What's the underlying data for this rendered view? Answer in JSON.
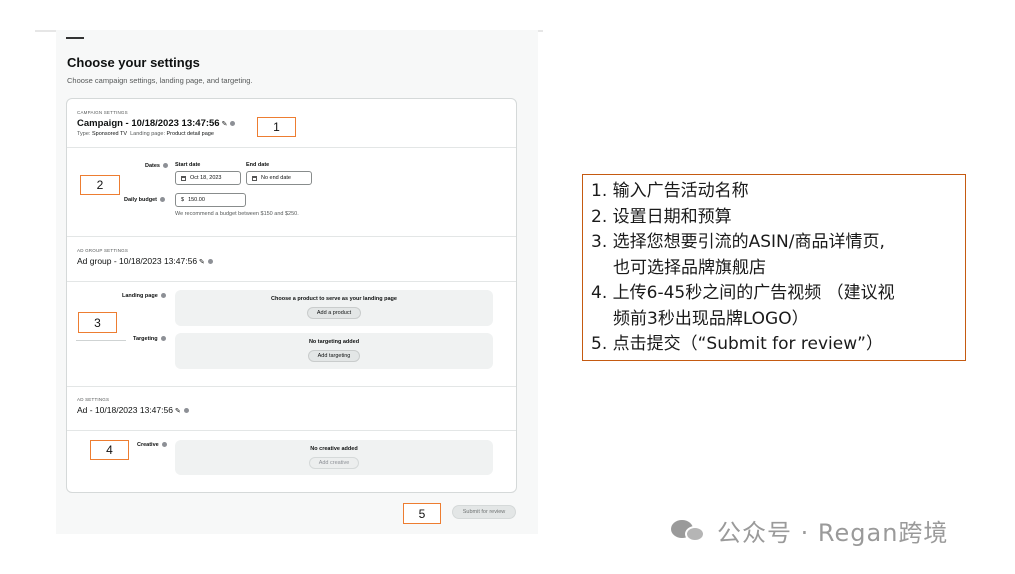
{
  "page": {
    "title": "Choose your settings",
    "subtitle": "Choose campaign settings, landing page, and targeting."
  },
  "campaign": {
    "section_label": "CAMPAIGN SETTINGS",
    "title": "Campaign - 10/18/2023 13:47:56",
    "type_key": "Type:",
    "type_value": "Sponsored TV",
    "landing_key": "Landing page:",
    "landing_value": "Product detail page",
    "dates_label": "Dates",
    "start_date_label": "Start date",
    "start_date_value": "Oct 18, 2023",
    "end_date_label": "End date",
    "end_date_value": "No end date",
    "budget_label": "Daily budget",
    "budget_currency": "$",
    "budget_value": "150.00",
    "budget_hint": "We recommend a budget between $150 and $250."
  },
  "ad_group": {
    "section_label": "AD GROUP SETTINGS",
    "title": "Ad group - 10/18/2023 13:47:56",
    "landing_label": "Landing page",
    "landing_box_text": "Choose a product to serve as your landing page",
    "add_product": "Add a product",
    "targeting_label": "Targeting",
    "targeting_box_text": "No targeting added",
    "add_targeting": "Add targeting"
  },
  "ad": {
    "section_label": "AD SETTINGS",
    "title": "Ad - 10/18/2023 13:47:56",
    "creative_label": "Creative",
    "creative_box_text": "No creative added",
    "add_creative": "Add creative"
  },
  "submit_label": "Submit for review",
  "pen_glyph": "✎",
  "markers": [
    "1",
    "2",
    "3",
    "4",
    "5"
  ],
  "notes": [
    "1. 输入广告活动名称",
    "2. 设置日期和预算",
    "3. 选择您想要引流的ASIN/商品详情页,",
    "也可选择品牌旗舰店",
    "4. 上传6-45秒之间的广告视频 （建议视",
    "频前3秒出现品牌LOGO）",
    "5. 点击提交（“Submit for review”）"
  ],
  "watermark": "公众号 · Regan跨境",
  "colors": {
    "marker_border": "#ed7d31",
    "notes_border": "#c55a11",
    "watermark": "#9a9a9a"
  }
}
